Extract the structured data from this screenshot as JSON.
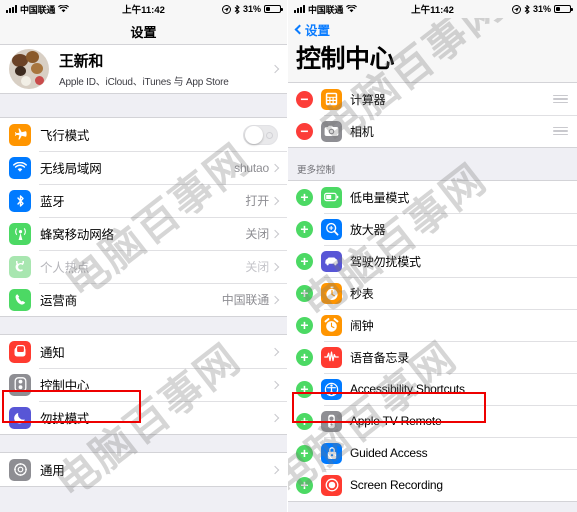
{
  "status_bar": {
    "carrier": "中国联通",
    "time": "上午11:42",
    "battery_percent": "31%",
    "wifi_icon": "wifi-icon",
    "bluetooth_icon": "bluetooth-icon",
    "location_icon": "location-icon",
    "battery_icon": "battery-icon",
    "signal_icon": "signal-bars-icon"
  },
  "left_screen": {
    "nav_title": "设置",
    "profile": {
      "name": "王新和",
      "subtitle": "Apple ID、iCloud、iTunes 与 App Store"
    },
    "group1": [
      {
        "label": "飞行模式",
        "icon": "airplane-icon",
        "icon_color": "#ff9500",
        "glyph": "✈",
        "control": "toggle",
        "toggle_on": false
      },
      {
        "label": "无线局域网",
        "icon": "wifi-icon",
        "icon_color": "#007aff",
        "glyph": "wifi",
        "value": "shutao",
        "control": "chevron"
      },
      {
        "label": "蓝牙",
        "icon": "bluetooth-icon",
        "icon_color": "#007aff",
        "glyph": "bt",
        "value": "打开",
        "control": "chevron"
      },
      {
        "label": "蜂窝移动网络",
        "icon": "cellular-icon",
        "icon_color": "#4cd964",
        "glyph": "cell",
        "value": "关闭",
        "control": "chevron"
      },
      {
        "label": "个人热点",
        "icon": "hotspot-icon",
        "icon_color": "#a8e6b0",
        "glyph": "hot",
        "value": "关闭",
        "control": "chevron",
        "dimmed": true
      },
      {
        "label": "运营商",
        "icon": "phone-icon",
        "icon_color": "#4cd964",
        "glyph": "phone",
        "value": "中国联通",
        "control": "chevron"
      }
    ],
    "group2": [
      {
        "label": "通知",
        "icon": "notifications-icon",
        "icon_color": "#ff3b30",
        "glyph": "notif",
        "control": "chevron"
      },
      {
        "label": "控制中心",
        "icon": "control-center-icon",
        "icon_color": "#8e8e93",
        "glyph": "cc",
        "control": "chevron",
        "highlighted": true
      },
      {
        "label": "勿扰模式",
        "icon": "do-not-disturb-icon",
        "icon_color": "#5856d6",
        "glyph": "moon",
        "control": "chevron"
      }
    ],
    "group3": [
      {
        "label": "通用",
        "icon": "general-gear-icon",
        "icon_color": "#8e8e93",
        "glyph": "gear",
        "control": "chevron"
      }
    ]
  },
  "right_screen": {
    "back_label": "设置",
    "title": "控制中心",
    "included": [
      {
        "label": "计算器",
        "action": "remove",
        "icon": "calculator-icon",
        "icon_color": "#ff9500",
        "glyph": "calc"
      },
      {
        "label": "相机",
        "action": "remove",
        "icon": "camera-icon",
        "icon_color": "#8e8e93",
        "glyph": "cam"
      }
    ],
    "more_controls_header": "更多控制",
    "more_controls": [
      {
        "label": "低电量模式",
        "action": "add",
        "icon": "low-power-mode-icon",
        "icon_color": "#4cd964",
        "glyph": "batt"
      },
      {
        "label": "放大器",
        "action": "add",
        "icon": "magnifier-icon",
        "icon_color": "#007aff",
        "glyph": "mag"
      },
      {
        "label": "驾驶勿扰模式",
        "action": "add",
        "icon": "do-not-disturb-driving-icon",
        "icon_color": "#5856d6",
        "glyph": "car"
      },
      {
        "label": "秒表",
        "action": "add",
        "icon": "stopwatch-icon",
        "icon_color": "#ff9500",
        "glyph": "stop"
      },
      {
        "label": "闹钟",
        "action": "add",
        "icon": "alarm-clock-icon",
        "icon_color": "#ff9500",
        "glyph": "alarm"
      },
      {
        "label": "语音备忘录",
        "action": "add",
        "icon": "voice-memos-icon",
        "icon_color": "#ff3b30",
        "glyph": "voice"
      },
      {
        "label": "Accessibility Shortcuts",
        "action": "add",
        "icon": "accessibility-icon",
        "icon_color": "#007aff",
        "glyph": "acc",
        "highlighted": true
      },
      {
        "label": "Apple TV Remote",
        "action": "add",
        "icon": "apple-tv-remote-icon",
        "icon_color": "#8e8e93",
        "glyph": "tv"
      },
      {
        "label": "Guided Access",
        "action": "add",
        "icon": "guided-access-icon",
        "icon_color": "#007aff",
        "glyph": "lock"
      },
      {
        "label": "Screen Recording",
        "action": "add",
        "icon": "screen-recording-icon",
        "icon_color": "#ff3b30",
        "glyph": "rec"
      }
    ]
  },
  "watermark": {
    "text": "电脑百事网"
  }
}
